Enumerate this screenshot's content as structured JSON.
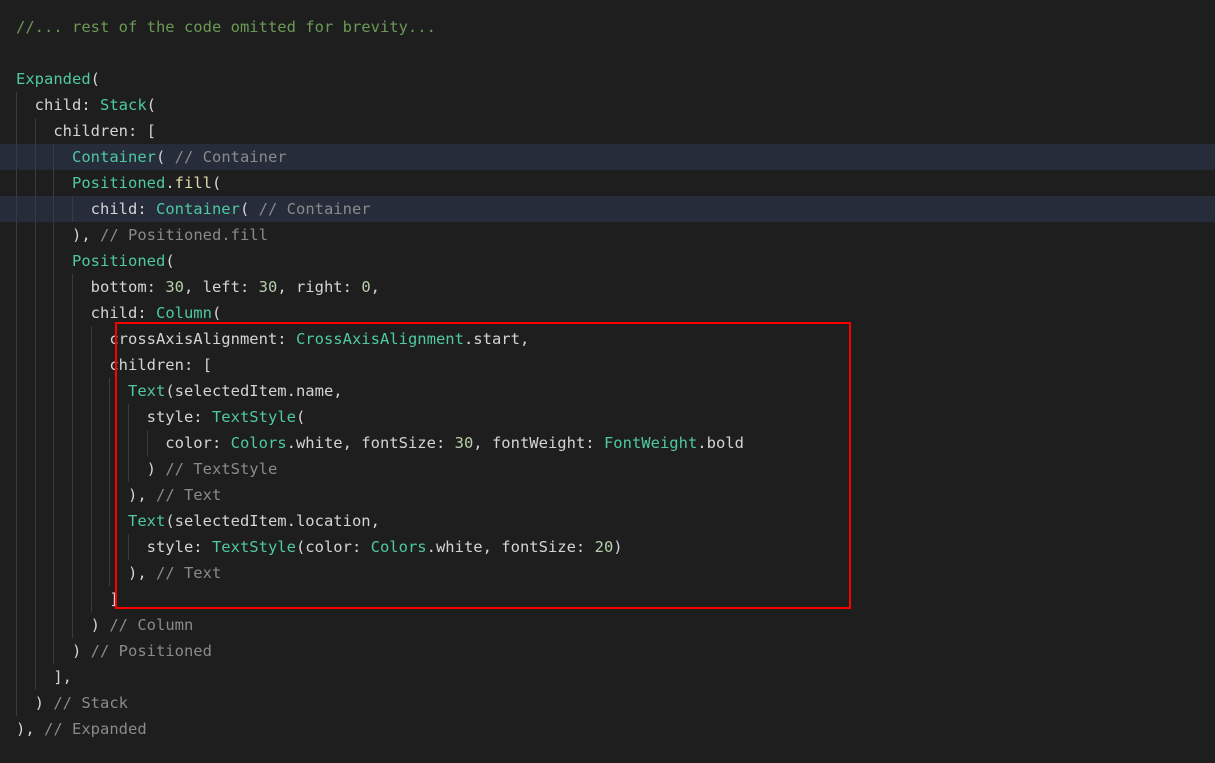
{
  "editor": {
    "background_color": "#1e1e1e",
    "highlight_row_color": "#262c3a",
    "annotation_color": "#fc0000",
    "language": "dart",
    "lines": [
      {
        "n": 1,
        "indent": 0,
        "highlighted": false,
        "text": "//... rest of the code omitted for brevity...",
        "tokens": [
          {
            "t": "//... rest of the code omitted for brevity...",
            "c": "t-comment-green"
          }
        ]
      },
      {
        "n": 2,
        "indent": 0,
        "highlighted": false,
        "text": "",
        "tokens": []
      },
      {
        "n": 3,
        "indent": 0,
        "highlighted": false,
        "text": "Expanded(",
        "tokens": [
          {
            "t": "Expanded",
            "c": "t-class"
          },
          {
            "t": "(",
            "c": "t-punct"
          }
        ]
      },
      {
        "n": 4,
        "indent": 1,
        "highlighted": false,
        "text": "  child: Stack(",
        "tokens": [
          {
            "t": "  child: ",
            "c": "t-plain"
          },
          {
            "t": "Stack",
            "c": "t-class"
          },
          {
            "t": "(",
            "c": "t-punct"
          }
        ]
      },
      {
        "n": 5,
        "indent": 2,
        "highlighted": false,
        "text": "    children: [",
        "tokens": [
          {
            "t": "    children: [",
            "c": "t-plain"
          }
        ]
      },
      {
        "n": 6,
        "indent": 3,
        "highlighted": true,
        "text": "      Container( // Container",
        "tokens": [
          {
            "t": "      ",
            "c": "t-plain"
          },
          {
            "t": "Container",
            "c": "t-class"
          },
          {
            "t": "( ",
            "c": "t-punct"
          },
          {
            "t": "// Container",
            "c": "t-comment"
          }
        ]
      },
      {
        "n": 7,
        "indent": 3,
        "highlighted": false,
        "text": "      Positioned.fill(",
        "tokens": [
          {
            "t": "      ",
            "c": "t-plain"
          },
          {
            "t": "Positioned",
            "c": "t-class"
          },
          {
            "t": ".",
            "c": "t-punct"
          },
          {
            "t": "fill",
            "c": "t-prop"
          },
          {
            "t": "(",
            "c": "t-punct"
          }
        ]
      },
      {
        "n": 8,
        "indent": 4,
        "highlighted": true,
        "text": "        child: Container( // Container",
        "tokens": [
          {
            "t": "        child: ",
            "c": "t-plain"
          },
          {
            "t": "Container",
            "c": "t-class"
          },
          {
            "t": "( ",
            "c": "t-punct"
          },
          {
            "t": "// Container",
            "c": "t-comment"
          }
        ]
      },
      {
        "n": 9,
        "indent": 3,
        "highlighted": false,
        "text": "      ), // Positioned.fill",
        "tokens": [
          {
            "t": "      ), ",
            "c": "t-plain"
          },
          {
            "t": "// Positioned.fill",
            "c": "t-comment"
          }
        ]
      },
      {
        "n": 10,
        "indent": 3,
        "highlighted": false,
        "text": "      Positioned(",
        "tokens": [
          {
            "t": "      ",
            "c": "t-plain"
          },
          {
            "t": "Positioned",
            "c": "t-class"
          },
          {
            "t": "(",
            "c": "t-punct"
          }
        ]
      },
      {
        "n": 11,
        "indent": 4,
        "highlighted": false,
        "text": "        bottom: 30, left: 30, right: 0,",
        "tokens": [
          {
            "t": "        bottom: ",
            "c": "t-plain"
          },
          {
            "t": "30",
            "c": "t-num"
          },
          {
            "t": ", left: ",
            "c": "t-plain"
          },
          {
            "t": "30",
            "c": "t-num"
          },
          {
            "t": ", right: ",
            "c": "t-plain"
          },
          {
            "t": "0",
            "c": "t-num"
          },
          {
            "t": ",",
            "c": "t-plain"
          }
        ]
      },
      {
        "n": 12,
        "indent": 4,
        "highlighted": false,
        "text": "        child: Column(",
        "tokens": [
          {
            "t": "        child: ",
            "c": "t-plain"
          },
          {
            "t": "Column",
            "c": "t-class"
          },
          {
            "t": "(",
            "c": "t-punct"
          }
        ]
      },
      {
        "n": 13,
        "indent": 5,
        "highlighted": false,
        "text": "          crossAxisAlignment: CrossAxisAlignment.start,",
        "tokens": [
          {
            "t": "          crossAxisAlignment: ",
            "c": "t-plain"
          },
          {
            "t": "CrossAxisAlignment",
            "c": "t-class"
          },
          {
            "t": ".start,",
            "c": "t-plain"
          }
        ]
      },
      {
        "n": 14,
        "indent": 5,
        "highlighted": false,
        "text": "          children: [",
        "tokens": [
          {
            "t": "          children: [",
            "c": "t-plain"
          }
        ]
      },
      {
        "n": 15,
        "indent": 6,
        "highlighted": false,
        "text": "            Text(selectedItem.name,",
        "tokens": [
          {
            "t": "            ",
            "c": "t-plain"
          },
          {
            "t": "Text",
            "c": "t-class"
          },
          {
            "t": "(selectedItem.name,",
            "c": "t-plain"
          }
        ]
      },
      {
        "n": 16,
        "indent": 7,
        "highlighted": false,
        "text": "              style: TextStyle(",
        "tokens": [
          {
            "t": "              style: ",
            "c": "t-plain"
          },
          {
            "t": "TextStyle",
            "c": "t-class"
          },
          {
            "t": "(",
            "c": "t-punct"
          }
        ]
      },
      {
        "n": 17,
        "indent": 8,
        "highlighted": false,
        "text": "                color: Colors.white, fontSize: 30, fontWeight: FontWeight.bold",
        "tokens": [
          {
            "t": "                color: ",
            "c": "t-plain"
          },
          {
            "t": "Colors",
            "c": "t-class"
          },
          {
            "t": ".white, fontSize: ",
            "c": "t-plain"
          },
          {
            "t": "30",
            "c": "t-num"
          },
          {
            "t": ", fontWeight: ",
            "c": "t-plain"
          },
          {
            "t": "FontWeight",
            "c": "t-class"
          },
          {
            "t": ".bold",
            "c": "t-plain"
          }
        ]
      },
      {
        "n": 18,
        "indent": 7,
        "highlighted": false,
        "text": "              ) // TextStyle",
        "tokens": [
          {
            "t": "              ) ",
            "c": "t-plain"
          },
          {
            "t": "// TextStyle",
            "c": "t-comment"
          }
        ]
      },
      {
        "n": 19,
        "indent": 6,
        "highlighted": false,
        "text": "            ), // Text",
        "tokens": [
          {
            "t": "            ), ",
            "c": "t-plain"
          },
          {
            "t": "// Text",
            "c": "t-comment"
          }
        ]
      },
      {
        "n": 20,
        "indent": 6,
        "highlighted": false,
        "text": "            Text(selectedItem.location,",
        "tokens": [
          {
            "t": "            ",
            "c": "t-plain"
          },
          {
            "t": "Text",
            "c": "t-class"
          },
          {
            "t": "(selectedItem.location,",
            "c": "t-plain"
          }
        ]
      },
      {
        "n": 21,
        "indent": 7,
        "highlighted": false,
        "text": "              style: TextStyle(color: Colors.white, fontSize: 20)",
        "tokens": [
          {
            "t": "              style: ",
            "c": "t-plain"
          },
          {
            "t": "TextStyle",
            "c": "t-class"
          },
          {
            "t": "(color: ",
            "c": "t-plain"
          },
          {
            "t": "Colors",
            "c": "t-class"
          },
          {
            "t": ".white, fontSize: ",
            "c": "t-plain"
          },
          {
            "t": "20",
            "c": "t-num"
          },
          {
            "t": ")",
            "c": "t-plain"
          }
        ]
      },
      {
        "n": 22,
        "indent": 6,
        "highlighted": false,
        "text": "            ), // Text",
        "tokens": [
          {
            "t": "            ), ",
            "c": "t-plain"
          },
          {
            "t": "// Text",
            "c": "t-comment"
          }
        ]
      },
      {
        "n": 23,
        "indent": 5,
        "highlighted": false,
        "text": "          ]",
        "tokens": [
          {
            "t": "          ]",
            "c": "t-plain"
          }
        ]
      },
      {
        "n": 24,
        "indent": 4,
        "highlighted": false,
        "text": "        ) // Column",
        "tokens": [
          {
            "t": "        ) ",
            "c": "t-plain"
          },
          {
            "t": "// Column",
            "c": "t-comment"
          }
        ]
      },
      {
        "n": 25,
        "indent": 3,
        "highlighted": false,
        "text": "      ) // Positioned",
        "tokens": [
          {
            "t": "      ) ",
            "c": "t-plain"
          },
          {
            "t": "// Positioned",
            "c": "t-comment"
          }
        ]
      },
      {
        "n": 26,
        "indent": 2,
        "highlighted": false,
        "text": "    ],",
        "tokens": [
          {
            "t": "    ],",
            "c": "t-plain"
          }
        ]
      },
      {
        "n": 27,
        "indent": 1,
        "highlighted": false,
        "text": "  ) // Stack",
        "tokens": [
          {
            "t": "  ) ",
            "c": "t-plain"
          },
          {
            "t": "// Stack",
            "c": "t-comment"
          }
        ]
      },
      {
        "n": 28,
        "indent": 0,
        "highlighted": false,
        "text": "), // Expanded",
        "tokens": [
          {
            "t": "), ",
            "c": "t-plain"
          },
          {
            "t": "// Expanded",
            "c": "t-comment"
          }
        ]
      }
    ]
  },
  "annotation": {
    "label": "highlighted-code-region",
    "color": "#fc0000",
    "covers_lines": [
      13,
      23
    ]
  }
}
